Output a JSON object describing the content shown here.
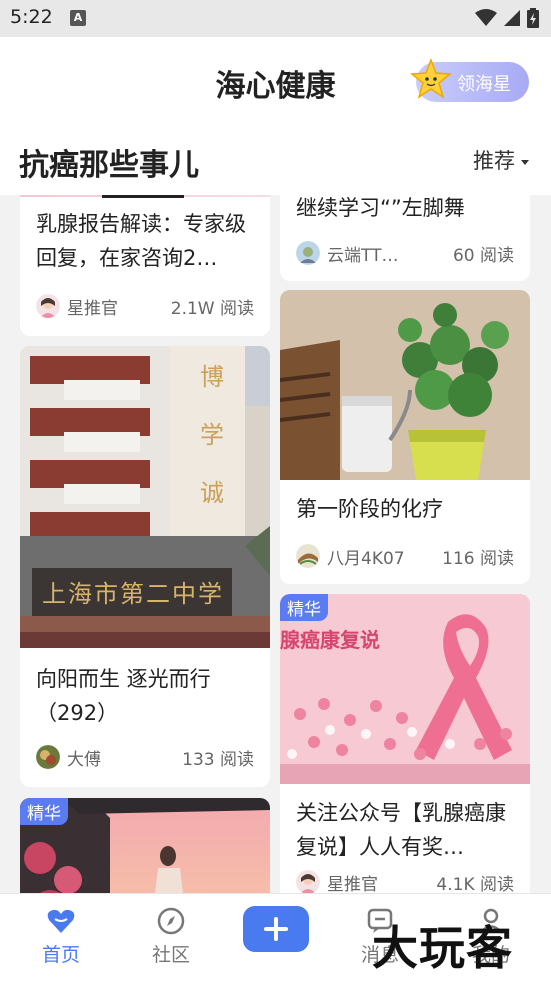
{
  "status_bar": {
    "time": "5:22",
    "notification_letter": "A"
  },
  "header": {
    "title": "海心健康",
    "star_button_label": "领海星"
  },
  "section": {
    "title": "抗癌那些事儿",
    "sort_label": "推荐"
  },
  "cards": {
    "left": [
      {
        "title": "乳腺报告解读：专家级回复，在家咨询2…",
        "author": "星推官",
        "reads": "2.1W 阅读"
      },
      {
        "title": "向阳而生  逐光而行（292）",
        "author": "大傅",
        "reads": "133 阅读",
        "image_sign_text": "上海市第二中学",
        "image_vertical_text": "博学诚"
      },
      {
        "badge": "精华"
      }
    ],
    "right": [
      {
        "title": "继续学习“”左脚舞",
        "author": "云端TT…",
        "reads": "60 阅读"
      },
      {
        "title": "第一阶段的化疗",
        "author": "八月4K07",
        "reads": "116 阅读"
      },
      {
        "badge": "精华",
        "image_text": "腺癌康复说",
        "title": "关注公众号【乳腺癌康复说】人人有奖…",
        "author": "星推官",
        "reads": "4.1K 阅读"
      }
    ]
  },
  "tab_bar": {
    "tabs": [
      {
        "label": "首页",
        "active": true
      },
      {
        "label": "社区",
        "active": false
      },
      {
        "label": "消息",
        "active": false
      },
      {
        "label": "我的",
        "active": false
      }
    ]
  },
  "watermark": "大玩客",
  "colors": {
    "accent": "#4a7af0",
    "badge": "#5b7cf0",
    "feed_bg": "#f2f2f2",
    "star_button": "#b6b8f6"
  },
  "icons": [
    "wifi-icon",
    "signal-icon",
    "battery-icon",
    "star-mascot-icon",
    "heart-icon",
    "compass-icon",
    "plus-icon",
    "message-icon",
    "profile-icon",
    "ribbon-icon"
  ]
}
